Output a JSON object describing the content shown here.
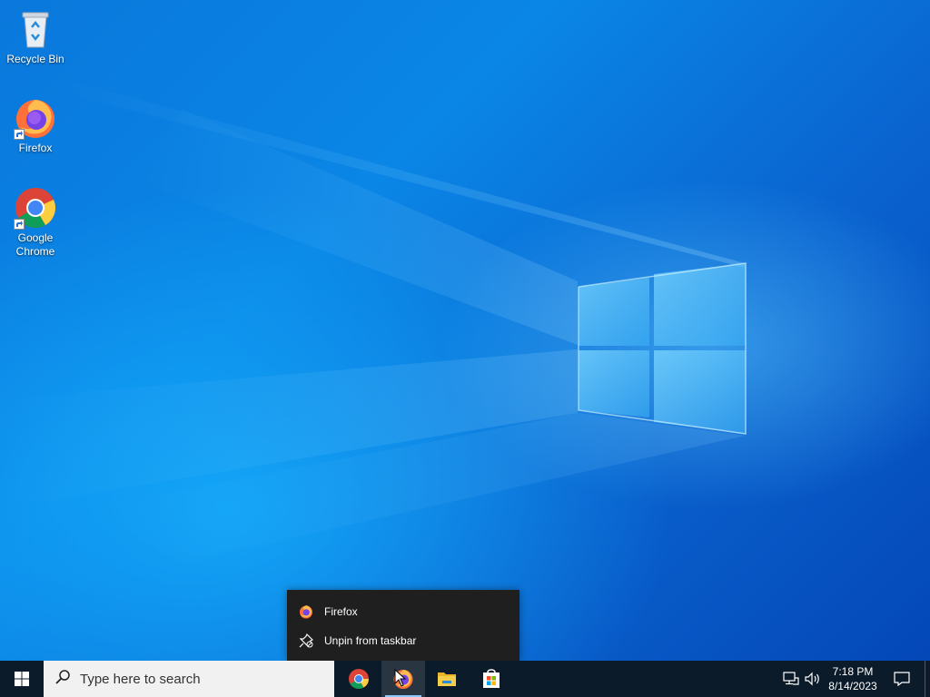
{
  "desktop": {
    "icons": [
      {
        "label": "Recycle Bin",
        "icon": "recycle-bin-icon"
      },
      {
        "label": "Firefox",
        "icon": "firefox-icon"
      },
      {
        "label": "Google Chrome",
        "icon": "chrome-icon"
      }
    ]
  },
  "jumplist": {
    "items": [
      {
        "label": "Firefox",
        "icon": "firefox-icon"
      },
      {
        "label": "Unpin from taskbar",
        "icon": "unpin-icon"
      }
    ]
  },
  "taskbar": {
    "search_placeholder": "Type here to search",
    "apps": [
      {
        "name": "Google Chrome",
        "icon": "chrome-icon"
      },
      {
        "name": "Firefox",
        "icon": "firefox-icon"
      },
      {
        "name": "File Explorer",
        "icon": "folder-icon"
      },
      {
        "name": "Microsoft Store",
        "icon": "store-icon"
      }
    ],
    "clock": {
      "time": "7:18 PM",
      "date": "8/14/2023"
    }
  },
  "colors": {
    "taskbar": "#0c1b2a",
    "menu_bg": "#1f1f1f",
    "accent": "#0a78dc"
  }
}
